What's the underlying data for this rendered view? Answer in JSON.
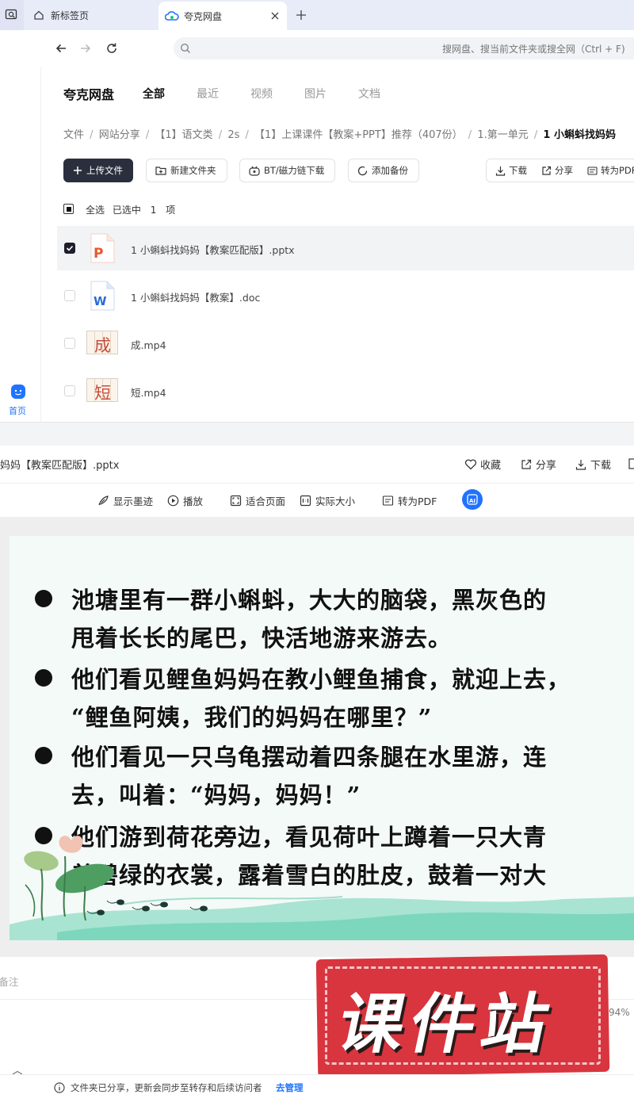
{
  "browser": {
    "tabs": [
      {
        "label": "新标签页",
        "icon": "home-icon"
      },
      {
        "label": "夸克网盘",
        "icon": "cloud-icon"
      }
    ],
    "new_tab_icon": "plus-icon",
    "address_placeholder": "搜网盘、搜当前文件夹或搜全网（Ctrl + F)"
  },
  "rail": {
    "home_label": "首页"
  },
  "drive": {
    "brand": "夸克网盘",
    "tabs": [
      "全部",
      "最近",
      "视频",
      "图片",
      "文档"
    ],
    "active_tab": "全部",
    "breadcrumb": [
      "文件",
      "网站分享",
      "【1】语文类",
      "2s",
      "【1】上课课件【教案+PPT】推荐（407份）",
      "1.第一单元",
      "1 小蝌蚪找妈妈"
    ],
    "actions": {
      "upload": "上传文件",
      "new_folder": "新建文件夹",
      "bt": "BT/磁力链下载",
      "backup": "添加备份",
      "download": "下载",
      "share": "分享",
      "convert": "转为PDF"
    },
    "select_all": "全选",
    "selected_label": "已选中",
    "selected_count": "1",
    "selected_unit": "项",
    "files": [
      {
        "name": "1 小蝌蚪找妈妈【教案匹配版】.pptx",
        "type": "pptx",
        "checked": true
      },
      {
        "name": "1 小蝌蚪找妈妈【教案】.doc",
        "type": "doc",
        "checked": false
      },
      {
        "name": "成.mp4",
        "type": "mp4",
        "thumb_char": "成",
        "checked": false
      },
      {
        "name": "短.mp4",
        "type": "mp4",
        "thumb_char": "短",
        "checked": false
      }
    ]
  },
  "preview": {
    "filename": "妈妈【教案匹配版】.pptx",
    "favorite": "收藏",
    "share": "分享",
    "download": "下载",
    "tools": {
      "ink": "显示墨迹",
      "play": "播放",
      "fit": "适合页面",
      "actual": "实际大小",
      "pdf": "转为PDF"
    },
    "slide_lines": [
      "池塘里有一群小蝌蚪，大大的脑袋，黑灰色的",
      "甩着长长的尾巴，快活地游来游去。",
      "他们看见鲤鱼妈妈在教小鲤鱼捕食，就迎上去，",
      "“鲤鱼阿姨，我们的妈妈在哪里？”",
      "他们看见一只乌龟摆动着四条腿在水里游，连",
      "去，叫着：“妈妈，妈妈！”",
      "他们游到荷花旁边，看见荷叶上蹲着一只大青",
      "着碧绿的衣裳，露着雪白的肚皮，鼓着一对大"
    ],
    "notes_label": "无备注",
    "zoom": "94%"
  },
  "watermark": "课件站",
  "footer": {
    "notice": "文件夹已分享，更新会同步至转存和后续访问者",
    "manage": "去管理"
  },
  "colors": {
    "primary_dark": "#2b2f3d",
    "accent_blue": "#1f73ff",
    "ppt_orange": "#e8572a",
    "word_blue": "#2a6bd8",
    "watermark_red": "#d8353f"
  }
}
